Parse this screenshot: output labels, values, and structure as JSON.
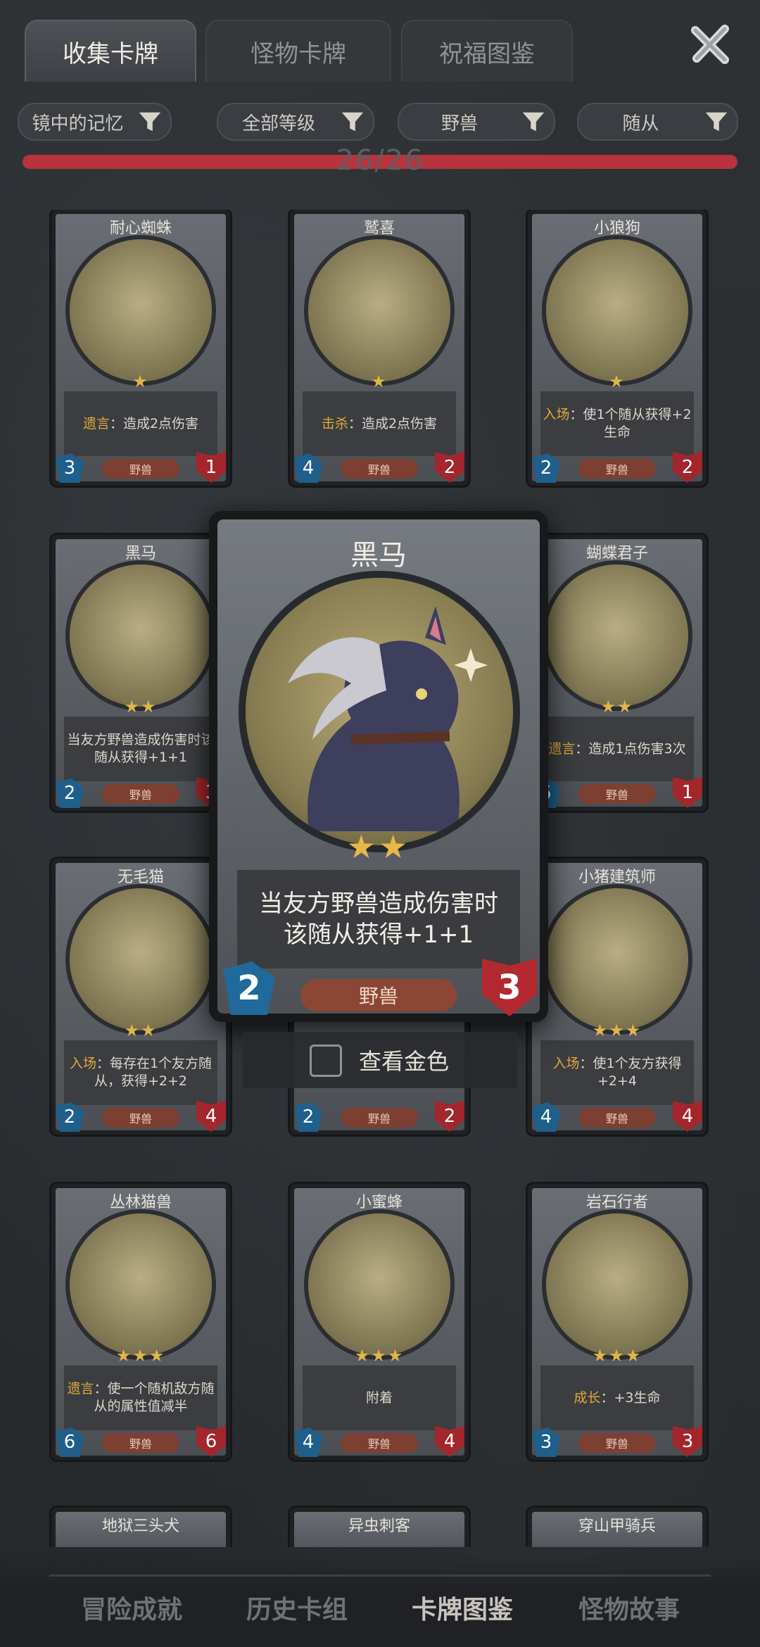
{
  "tabs": [
    "收集卡牌",
    "怪物卡牌",
    "祝福图鉴"
  ],
  "filters": [
    "镜中的记忆",
    "全部等级",
    "野兽",
    "随从"
  ],
  "progress": {
    "text": "26/26",
    "fraction": 1.0
  },
  "cards": [
    {
      "name": "耐心蜘蛛",
      "stars": "★",
      "desc_kw": "遗言",
      "desc": "：造成2点伤害",
      "type": "野兽",
      "atk": "3",
      "hp": "1"
    },
    {
      "name": "鹫喜",
      "stars": "★",
      "desc_kw": "击杀",
      "desc": "：造成2点伤害",
      "type": "野兽",
      "atk": "4",
      "hp": "2"
    },
    {
      "name": "小狼狗",
      "stars": "★",
      "desc_kw": "入场",
      "desc": "：使1个随从获得+2生命",
      "type": "野兽",
      "atk": "2",
      "hp": "2"
    },
    {
      "name": "黑马",
      "stars": "★★",
      "desc_kw": "",
      "desc": "当友方野兽造成伤害时该随从获得+1+1",
      "type": "野兽",
      "atk": "2",
      "hp": "3"
    },
    {
      "name": "蝴蝶君子",
      "stars": "★★",
      "desc_kw": "遗言",
      "desc": "：造成1点伤害3次",
      "type": "野兽",
      "atk": "5",
      "hp": "1"
    },
    {
      "name": "无毛猫",
      "stars": "★★",
      "desc_kw": "入场",
      "desc": "：每存在1个友方随从，获得+2+2",
      "type": "野兽",
      "atk": "2",
      "hp": "4"
    },
    {
      "name": "小猪建筑师",
      "stars": "★★★",
      "desc_kw": "入场",
      "desc": "：使1个友方获得+2+4",
      "type": "野兽",
      "atk": "4",
      "hp": "4"
    },
    {
      "name": "丛林猫兽",
      "stars": "★★★",
      "desc_kw": "遗言",
      "desc": "：使一个随机敌方随从的属性值减半",
      "type": "野兽",
      "atk": "6",
      "hp": "6"
    },
    {
      "name": "小蜜蜂",
      "stars": "★★★",
      "desc_kw": "",
      "desc": "附着",
      "type": "野兽",
      "atk": "4",
      "hp": "4"
    },
    {
      "name": "岩石行者",
      "stars": "★★★",
      "desc_kw": "成长",
      "desc": "：+3生命",
      "type": "野兽",
      "atk": "3",
      "hp": "3"
    }
  ],
  "row5_names": [
    "地狱三头犬",
    "异虫刺客",
    "穿山甲骑兵"
  ],
  "hidden_middle_card": {
    "type": "野兽",
    "atk": "2",
    "hp": "2"
  },
  "detail": {
    "name": "黑马",
    "stars": "★★",
    "desc_line1": "当友方野兽造成伤害时",
    "desc_line2": "该随从获得+1+1",
    "type": "野兽",
    "atk": "2",
    "hp": "3"
  },
  "gold_toggle": "查看金色",
  "bottom_nav": [
    "冒险成就",
    "历史卡组",
    "卡牌图鉴",
    "怪物故事"
  ],
  "colors": {
    "accent_red": "#b8333d",
    "atk_blue": "#1f6a9b",
    "hp_red": "#b2292f",
    "keyword": "#e0a83a"
  }
}
